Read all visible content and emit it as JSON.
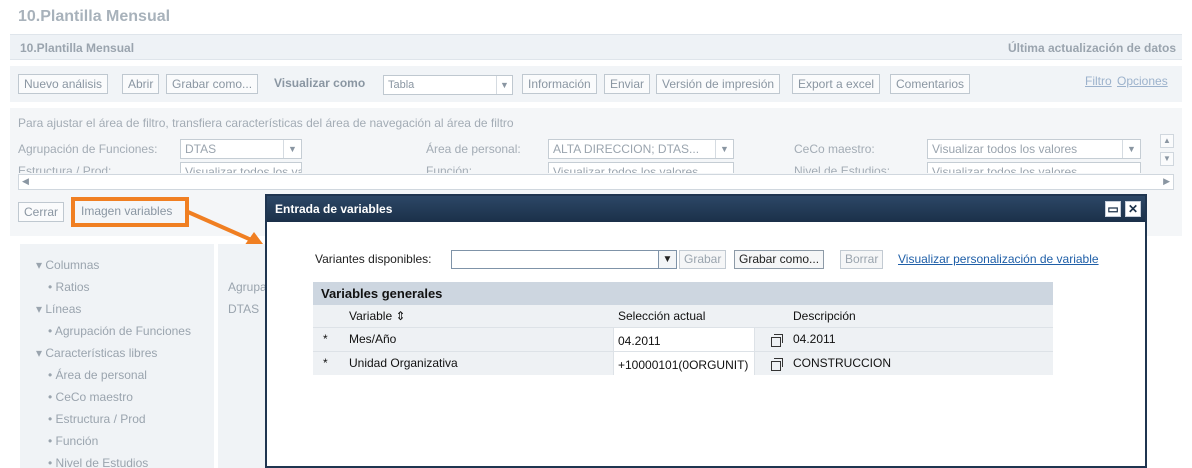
{
  "page_title": "10.Plantilla Mensual",
  "header": {
    "title": "10.Plantilla Mensual",
    "last_update": "Última actualización de datos"
  },
  "toolbar": {
    "new_analysis": "Nuevo análisis",
    "open": "Abrir",
    "save_as": "Grabar como...",
    "visualize_label": "Visualizar como",
    "visualize_value": "Tabla",
    "information": "Información",
    "send": "Enviar",
    "print_version": "Versión de impresión",
    "export_excel": "Export a excel",
    "comments": "Comentarios",
    "filter_link": "Filtro",
    "options_link": "Opciones"
  },
  "filter": {
    "hint": "Para ajustar el área de filtro, transfiera características del área de navegación al área de filtro",
    "row1": [
      {
        "label": "Agrupación de Funciones:",
        "value": "DTAS"
      },
      {
        "label": "Área de personal:",
        "value": "ALTA DIRECCION; DTAS..."
      },
      {
        "label": "CeCo maestro:",
        "value": "Visualizar todos los valores"
      }
    ],
    "row2": [
      {
        "label": "Estructura / Prod:",
        "value": "Visualizar todos los valores"
      },
      {
        "label": "Función:",
        "value": "Visualizar todos los valores"
      },
      {
        "label": "Nivel de Estudios:",
        "value": "Visualizar todos los valores"
      }
    ]
  },
  "actions": {
    "close": "Cerrar",
    "variable_screen": "Imagen variables"
  },
  "nav": {
    "sections": [
      {
        "title": "Columnas",
        "items": [
          "Ratios"
        ]
      },
      {
        "title": "Líneas",
        "items": [
          "Agrupación de Funciones"
        ]
      },
      {
        "title": "Características libres",
        "items": [
          "Área de personal",
          "CeCo maestro",
          "Estructura / Prod",
          "Función",
          "Nivel de Estudios"
        ]
      }
    ]
  },
  "table_preview": {
    "header": "Agrupa",
    "value": "DTAS"
  },
  "dialog": {
    "title": "Entrada de variables",
    "variants_label": "Variantes disponibles:",
    "variants_value": "",
    "save": "Grabar",
    "save_as": "Grabar como...",
    "delete": "Borrar",
    "personalize_link": "Visualizar personalización de variable",
    "group_title": "Variables generales",
    "columns": {
      "variable": "Variable",
      "selection": "Selección actual",
      "description": "Descripción"
    },
    "rows": [
      {
        "required": "*",
        "variable": "Mes/Año",
        "selection": "04.2011",
        "description": "04.2011"
      },
      {
        "required": "*",
        "variable": "Unidad Organizativa",
        "selection": "+10000101(0ORGUNIT)",
        "description": "CONSTRUCCION"
      }
    ]
  },
  "colors": {
    "accent": "#f07f22",
    "dialog_title": "#1b3049",
    "link": "#1f5fa8"
  }
}
